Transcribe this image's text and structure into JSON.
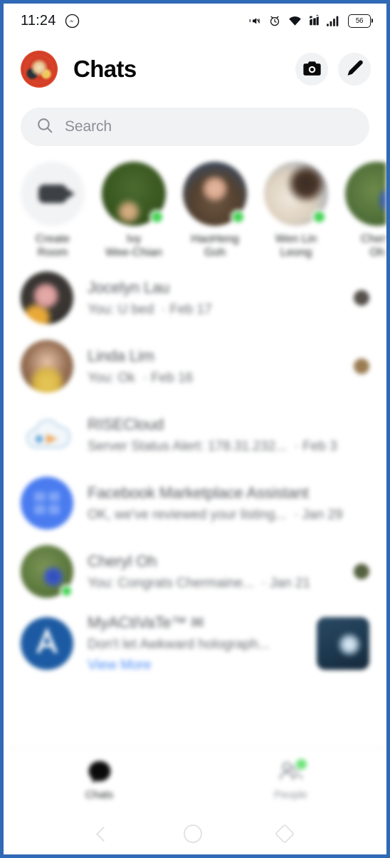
{
  "status_bar": {
    "time": "11:24",
    "app_icon": "messenger-icon",
    "icons": [
      "vibrate-icon",
      "alarm-icon",
      "wifi-icon",
      "sim-icon",
      "signal-icon"
    ],
    "battery_level": "56"
  },
  "header": {
    "title": "Chats",
    "avatar_name": "profile-avatar",
    "camera_label": "Camera",
    "compose_label": "New message"
  },
  "search": {
    "placeholder": "Search",
    "icon": "search-icon"
  },
  "stories": [
    {
      "label": "Create\nRoom",
      "label_line1": "Create",
      "label_line2": "Room",
      "icon": "video-camera-icon",
      "active": false
    },
    {
      "label_line1": "Ivy",
      "label_line2": "Wee-Chian",
      "active": true
    },
    {
      "label_line1": "HaoHeng",
      "label_line2": "Goh",
      "active": true
    },
    {
      "label_line1": "Wen Lin",
      "label_line2": "Leong",
      "active": true
    },
    {
      "label_line1": "Cheryl",
      "label_line2": "Oh",
      "active": false
    }
  ],
  "chats": [
    {
      "name": "Jocelyn Lau",
      "snippet": "You: U bed",
      "time": "Feb 17",
      "seen": true,
      "active": false
    },
    {
      "name": "Linda Lim",
      "snippet": "You: Ok",
      "time": "Feb 16",
      "seen": true,
      "active": false
    },
    {
      "name": "RISECloud",
      "snippet": "Server Status Alert: 178.31.232...",
      "time": "Feb 3",
      "seen": false,
      "active": false
    },
    {
      "name": "Facebook Marketplace Assistant",
      "snippet": "OK, we've reviewed your listing...",
      "time": "Jan 29",
      "seen": false,
      "active": false
    },
    {
      "name": "Cheryl Oh",
      "snippet": "You: Congrats Chermaine...",
      "time": "Jan 21",
      "seen": true,
      "active": true
    },
    {
      "name": "MyACtiVaTe™ ✉",
      "snippet": "Don't let Awkward holograph...",
      "link": "View More",
      "seen": false,
      "active": false,
      "has_thumbnail": true
    }
  ],
  "tabs": [
    {
      "label": "Chats",
      "icon": "chat-bubble-icon",
      "active": true,
      "badge": false
    },
    {
      "label": "People",
      "icon": "people-icon",
      "active": false,
      "badge": true
    }
  ],
  "android_nav": {
    "back": "back-button",
    "home": "home-button",
    "recents": "recents-button"
  },
  "colors": {
    "accent": "#4a8bf5",
    "active_green": "#44d354",
    "border": "#3069b5",
    "chip_bg": "#f1f2f4"
  }
}
